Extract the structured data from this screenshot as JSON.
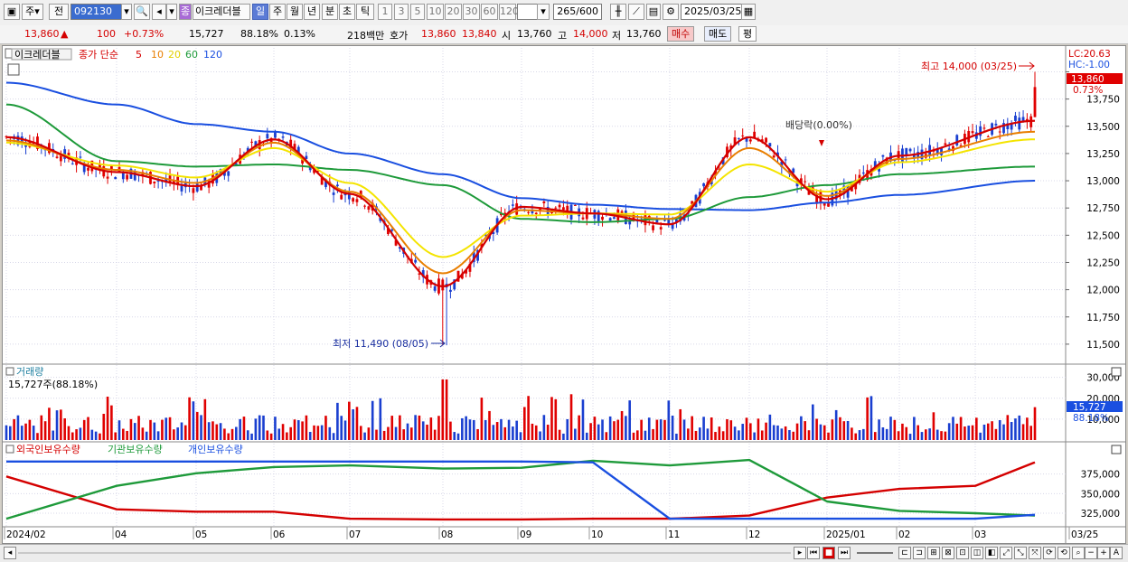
{
  "toolbar": {
    "market_label": "주",
    "prev_label": "전",
    "code": "092130",
    "name": "이크레더블",
    "period_day": "일",
    "period_week": "주",
    "period_month": "월",
    "period_year": "년",
    "period_min": "분",
    "period_sec": "초",
    "period_tick": "틱",
    "intervals": [
      "1",
      "3",
      "5",
      "10",
      "20",
      "30",
      "60",
      "120"
    ],
    "count": "265",
    "count_total": "/600",
    "date": "2025/03/25",
    "favorite_badge": "종"
  },
  "info": {
    "price": "13,860",
    "arrow": "▲",
    "change": "100",
    "change_pct": "+0.73%",
    "volume": "15,727",
    "volume_ratio": "88.18%",
    "turnover": "0.13%",
    "amount": "218백만",
    "quote_label": "호가",
    "ask": "13,860",
    "bid": "13,840",
    "open_label": "시",
    "open": "13,760",
    "high_label": "고",
    "high": "14,000",
    "low_label": "저",
    "low": "13,760",
    "buy": "매수",
    "sell": "매도",
    "eval": "평"
  },
  "legend": {
    "name": "이크레더블",
    "ma_label": "종가 단순",
    "ma_periods": [
      "5",
      "10",
      "20",
      "60",
      "120"
    ],
    "ma_colors": [
      "#d40000",
      "#e87e00",
      "#f4e400",
      "#1e9a3a",
      "#1a4fe0"
    ]
  },
  "annotations": {
    "high": "최고 14,000 (03/25)",
    "low": "최저 11,490 (08/05)",
    "dividend": "배당락(0.00%)",
    "lc": "LC:20.63",
    "hc": "HC:-1.00",
    "last_tag": "13,860",
    "last_pct": "0.73%"
  },
  "volume_panel": {
    "title": "거래량",
    "value": "15,727주(88.18%)",
    "last_tag": "15,727",
    "last_pct": "88.18%"
  },
  "holdings_panel": {
    "series": [
      "외국인보유수량",
      "기관보유수량",
      "개인보유수량"
    ],
    "series_colors": [
      "#d40000",
      "#1e9a3a",
      "#1a4fe0"
    ]
  },
  "x_labels": [
    "2024/02",
    "04",
    "05",
    "06",
    "07",
    "08",
    "09",
    "10",
    "11",
    "12",
    "2025/01",
    "02",
    "03",
    "03/25"
  ],
  "chart_data": [
    {
      "type": "line",
      "title": "",
      "y_ticks": [
        14000,
        13750,
        13500,
        13250,
        13000,
        12750,
        12500,
        12250,
        12000,
        11750,
        11500
      ],
      "y_tick_labels": [
        "",
        "13,750",
        "13,500",
        "13,250",
        "13,000",
        "12,750",
        "12,500",
        "12,250",
        "12,000",
        "11,750",
        "11,500"
      ],
      "ylim": [
        11350,
        14120
      ],
      "x": [
        "2024/02",
        "04",
        "05",
        "06",
        "07",
        "08",
        "09",
        "10",
        "11",
        "12",
        "2025/01",
        "02",
        "03"
      ],
      "series": [
        {
          "name": "5",
          "values": [
            13400,
            13080,
            12950,
            13380,
            12880,
            12030,
            12760,
            12700,
            12600,
            13400,
            12830,
            13230,
            13550
          ]
        },
        {
          "name": "10",
          "values": [
            13370,
            13100,
            12980,
            13350,
            12900,
            12150,
            12730,
            12700,
            12650,
            13300,
            12860,
            13200,
            13450
          ]
        },
        {
          "name": "20",
          "values": [
            13350,
            13140,
            13030,
            13300,
            12980,
            12300,
            12680,
            12700,
            12690,
            13150,
            12900,
            13170,
            13380
          ]
        },
        {
          "name": "60",
          "values": [
            13700,
            13180,
            13130,
            13150,
            13100,
            12960,
            12650,
            12620,
            12650,
            12850,
            12960,
            13060,
            13130
          ]
        },
        {
          "name": "120",
          "values": [
            13900,
            13700,
            13520,
            13450,
            13250,
            13060,
            12840,
            12780,
            12740,
            12730,
            12800,
            12870,
            13000
          ]
        }
      ],
      "high": 14000,
      "low": 11490,
      "last": 13860
    },
    {
      "type": "bar",
      "title": "",
      "y_tick_labels": [
        "30,000",
        "20,000",
        "10,000"
      ],
      "ylim": [
        0,
        32000
      ],
      "last": 15727
    },
    {
      "type": "line",
      "title": "",
      "y_tick_labels": [
        "375,000",
        "350,000",
        "325,000"
      ],
      "ylim": [
        310000,
        400000
      ],
      "x": [
        "2024/02",
        "04",
        "05",
        "06",
        "07",
        "08",
        "09",
        "10",
        "11",
        "12",
        "2025/01",
        "02",
        "03",
        "03/25"
      ],
      "series": [
        {
          "name": "외국인보유수량",
          "values": [
            372000,
            330000,
            327000,
            327000,
            318000,
            317000,
            317000,
            318000,
            318000,
            322000,
            345000,
            356000,
            360000,
            390000
          ]
        },
        {
          "name": "기관보유수량",
          "values": [
            318000,
            360000,
            376000,
            384000,
            386000,
            382000,
            383000,
            392000,
            386000,
            393000,
            340000,
            328000,
            325000,
            322000
          ]
        },
        {
          "name": "개인보유수량",
          "values": [
            391000,
            391000,
            391000,
            391000,
            391000,
            391000,
            391000,
            390000,
            318000,
            318000,
            318000,
            318000,
            318000,
            323000
          ]
        }
      ]
    }
  ]
}
